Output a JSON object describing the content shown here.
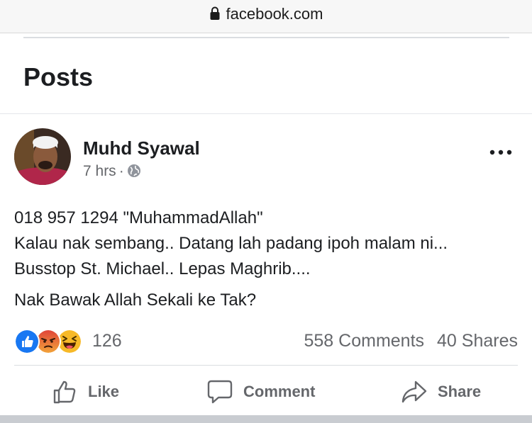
{
  "browser": {
    "url": "facebook.com"
  },
  "section": {
    "title": "Posts"
  },
  "post": {
    "author": "Muhd Syawal",
    "time": "7 hrs",
    "separator": "·",
    "text_lines": [
      "018 957 1294 \"MuhammadAllah\"",
      "Kalau nak sembang.. Datang lah padang ipoh malam ni... Busstop St. Michael.. Lepas Maghrib....",
      "Nak Bawak Allah Sekali ke Tak?"
    ],
    "reactions": {
      "types": [
        "like-icon",
        "angry-icon",
        "haha-icon"
      ],
      "count": "126"
    },
    "comments": "558 Comments",
    "shares": "40 Shares",
    "actions": {
      "like": "Like",
      "comment": "Comment",
      "share": "Share"
    }
  },
  "colors": {
    "like_blue": "#1877f2",
    "angry_orange": "#e9710f",
    "haha_yellow": "#f7b928",
    "secondary_text": "#65676b"
  }
}
